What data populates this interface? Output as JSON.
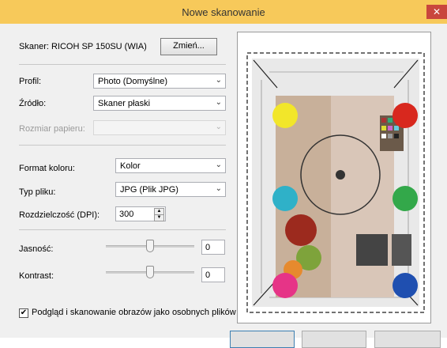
{
  "window": {
    "title": "Nowe skanowanie",
    "close_glyph": "✕"
  },
  "scanner": {
    "label": "Skaner: RICOH SP 150SU (WIA)",
    "change_button": "Zmień..."
  },
  "profile": {
    "label": "Profil:",
    "value": "Photo (Domyślne)"
  },
  "source": {
    "label": "Źródło:",
    "value": "Skaner płaski"
  },
  "paper_size": {
    "label": "Rozmiar papieru:",
    "value": ""
  },
  "color_format": {
    "label": "Format koloru:",
    "value": "Kolor"
  },
  "file_type": {
    "label": "Typ pliku:",
    "value": "JPG (Plik JPG)"
  },
  "resolution": {
    "label": "Rozdzielczość (DPI):",
    "value": "300"
  },
  "brightness": {
    "label": "Jasność:",
    "value": "0"
  },
  "contrast": {
    "label": "Kontrast:",
    "value": "0"
  },
  "separate_files": {
    "checked": true,
    "label": "Podgląd i skanowanie obrazów jako osobnych plików"
  },
  "icons": {
    "dropdown": "chevron-down-icon",
    "check": "check-icon",
    "spin_up": "up-arrow-icon",
    "spin_down": "down-arrow-icon"
  },
  "colors": {
    "titlebar": "#f7c95a",
    "close": "#c9463d",
    "primary_button_border": "#3c7fb1"
  }
}
